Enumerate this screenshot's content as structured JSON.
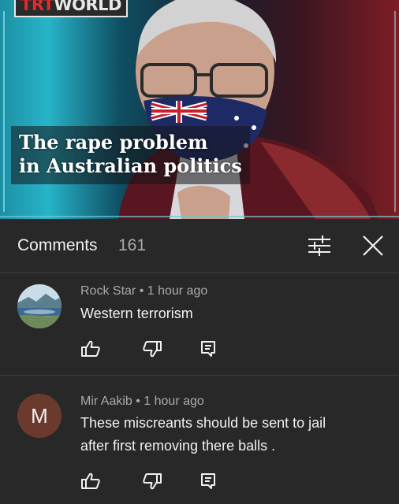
{
  "video": {
    "logo_part1": "TRT",
    "logo_part2": "WORLD",
    "headline_line1": "The rape problem",
    "headline_line2": "in Australian politics"
  },
  "comments_panel": {
    "title": "Comments",
    "count": "161",
    "icons": {
      "filter": "filter-sliders-icon",
      "close": "close-icon"
    }
  },
  "comments": [
    {
      "author": "Rock Star",
      "time": "1 hour ago",
      "meta": "Rock Star • 1 hour ago",
      "text": "Western terrorism",
      "avatar_type": "landscape-image"
    },
    {
      "author": "Mir Aakib",
      "time": "1 hour ago",
      "meta": "Mir Aakib • 1 hour ago",
      "avatar_letter": "M",
      "text_line1": "These miscreants should be sent to jail",
      "text_line2": "after first removing there balls ."
    }
  ],
  "action_icons": [
    "thumbs-up-icon",
    "thumbs-down-icon",
    "reply-icon"
  ],
  "colors": {
    "background": "#282828",
    "primary_text": "#f1f1f1",
    "secondary_text": "#aaaaaa",
    "avatar_m": "#6b3a2e"
  }
}
